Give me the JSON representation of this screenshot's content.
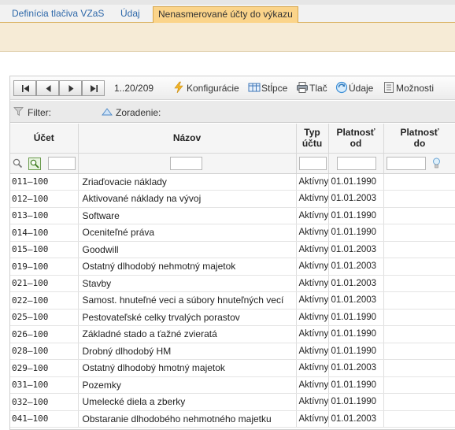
{
  "tabs": [
    {
      "label": "Definícia tlačiva VZaS"
    },
    {
      "label": "Údaj"
    },
    {
      "label": "Nenasmerované účty do výkazu"
    }
  ],
  "toolbar": {
    "page_info": "1..20/209",
    "configure": "Konfigurácie",
    "columns": "Stĺpce",
    "print": "Tlač",
    "data": "Údaje",
    "options": "Možnosti"
  },
  "filterbar": {
    "filter_label": "Filter:",
    "sort_label": "Zoradenie:"
  },
  "columns": {
    "account": "Účet",
    "name": "Názov",
    "type": "Typ\núčtu",
    "valid_from": "Platnosť\nod",
    "valid_to": "Platnosť\ndo"
  },
  "filters": {
    "account": "",
    "name": "",
    "type": "",
    "valid_from": "",
    "valid_to": ""
  },
  "icons": {
    "first": "first-page-icon",
    "prev": "prev-page-icon",
    "next": "next-page-icon",
    "last": "last-page-icon",
    "configure": "lightning-icon",
    "columns": "columns-icon",
    "print": "printer-icon",
    "data": "refresh-data-icon",
    "options": "options-icon",
    "filter": "funnel-icon",
    "sort": "sort-triangle-icon",
    "search": "magnifier-icon",
    "clear": "clear-filter-icon",
    "hint": "lightbulb-icon"
  },
  "colors": {
    "active_tab": "#fbd48a",
    "tab_link": "#2c67a9",
    "band": "#f6ebd6"
  },
  "rows": [
    {
      "account": "011–100",
      "name": "Zriaďovacie náklady",
      "type": "Aktívny",
      "valid_from": "01.01.1990",
      "valid_to": ""
    },
    {
      "account": "012–100",
      "name": "Aktivované náklady na vývoj",
      "type": "Aktívny",
      "valid_from": "01.01.2003",
      "valid_to": ""
    },
    {
      "account": "013–100",
      "name": "Software",
      "type": "Aktívny",
      "valid_from": "01.01.1990",
      "valid_to": ""
    },
    {
      "account": "014–100",
      "name": "Oceniteľné práva",
      "type": "Aktívny",
      "valid_from": "01.01.1990",
      "valid_to": ""
    },
    {
      "account": "015–100",
      "name": "Goodwill",
      "type": "Aktívny",
      "valid_from": "01.01.2003",
      "valid_to": ""
    },
    {
      "account": "019–100",
      "name": "Ostatný dlhodobý nehmotný majetok",
      "type": "Aktívny",
      "valid_from": "01.01.2003",
      "valid_to": ""
    },
    {
      "account": "021–100",
      "name": "Stavby",
      "type": "Aktívny",
      "valid_from": "01.01.2003",
      "valid_to": ""
    },
    {
      "account": "022–100",
      "name": "Samost. hnuteľné veci a súbory hnuteľných vecí",
      "type": "Aktívny",
      "valid_from": "01.01.2003",
      "valid_to": ""
    },
    {
      "account": "025–100",
      "name": "Pestovateľské celky trvalých porastov",
      "type": "Aktívny",
      "valid_from": "01.01.1990",
      "valid_to": ""
    },
    {
      "account": "026–100",
      "name": "Základné stado a ťažné zvieratá",
      "type": "Aktívny",
      "valid_from": "01.01.1990",
      "valid_to": ""
    },
    {
      "account": "028–100",
      "name": "Drobný dlhodobý HM",
      "type": "Aktívny",
      "valid_from": "01.01.1990",
      "valid_to": ""
    },
    {
      "account": "029–100",
      "name": "Ostatný dlhodobý hmotný majetok",
      "type": "Aktívny",
      "valid_from": "01.01.2003",
      "valid_to": ""
    },
    {
      "account": "031–100",
      "name": "Pozemky",
      "type": "Aktívny",
      "valid_from": "01.01.1990",
      "valid_to": ""
    },
    {
      "account": "032–100",
      "name": "Umelecké diela a zberky",
      "type": "Aktívny",
      "valid_from": "01.01.1990",
      "valid_to": ""
    },
    {
      "account": "041–100",
      "name": "Obstaranie dlhodobého nehmotného majetku",
      "type": "Aktívny",
      "valid_from": "01.01.2003",
      "valid_to": ""
    }
  ]
}
